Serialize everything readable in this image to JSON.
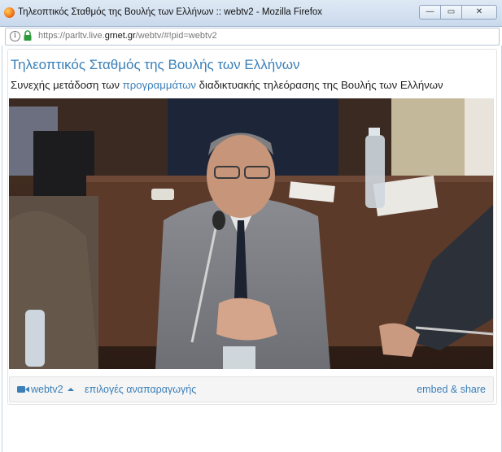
{
  "window": {
    "title": "Τηλεοπτικός Σταθμός της Βουλής των Ελλήνων :: webtv2 - Mozilla Firefox",
    "minimize_glyph": "—",
    "maximize_glyph": "▭",
    "close_glyph": "✕"
  },
  "address": {
    "info_glyph": "i",
    "url_prefix": "https://parltv.live.",
    "url_host": "grnet.gr",
    "url_suffix": "/webtv/#!pid=webtv2"
  },
  "page": {
    "heading": "Τηλεοπτικός Σταθμός της Βουλής των Ελλήνων",
    "subtitle_before": "Συνεχής μετάδοση των ",
    "subtitle_link": "προγραμμάτων",
    "subtitle_after": " διαδικτυακής τηλεόρασης της Βουλής των Ελλήνων"
  },
  "player": {
    "channel_label": "webtv2",
    "playback_options": "επιλογές αναπαραγωγής",
    "embed_share": "embed & share"
  },
  "colors": {
    "accent": "#3a7fb8"
  }
}
